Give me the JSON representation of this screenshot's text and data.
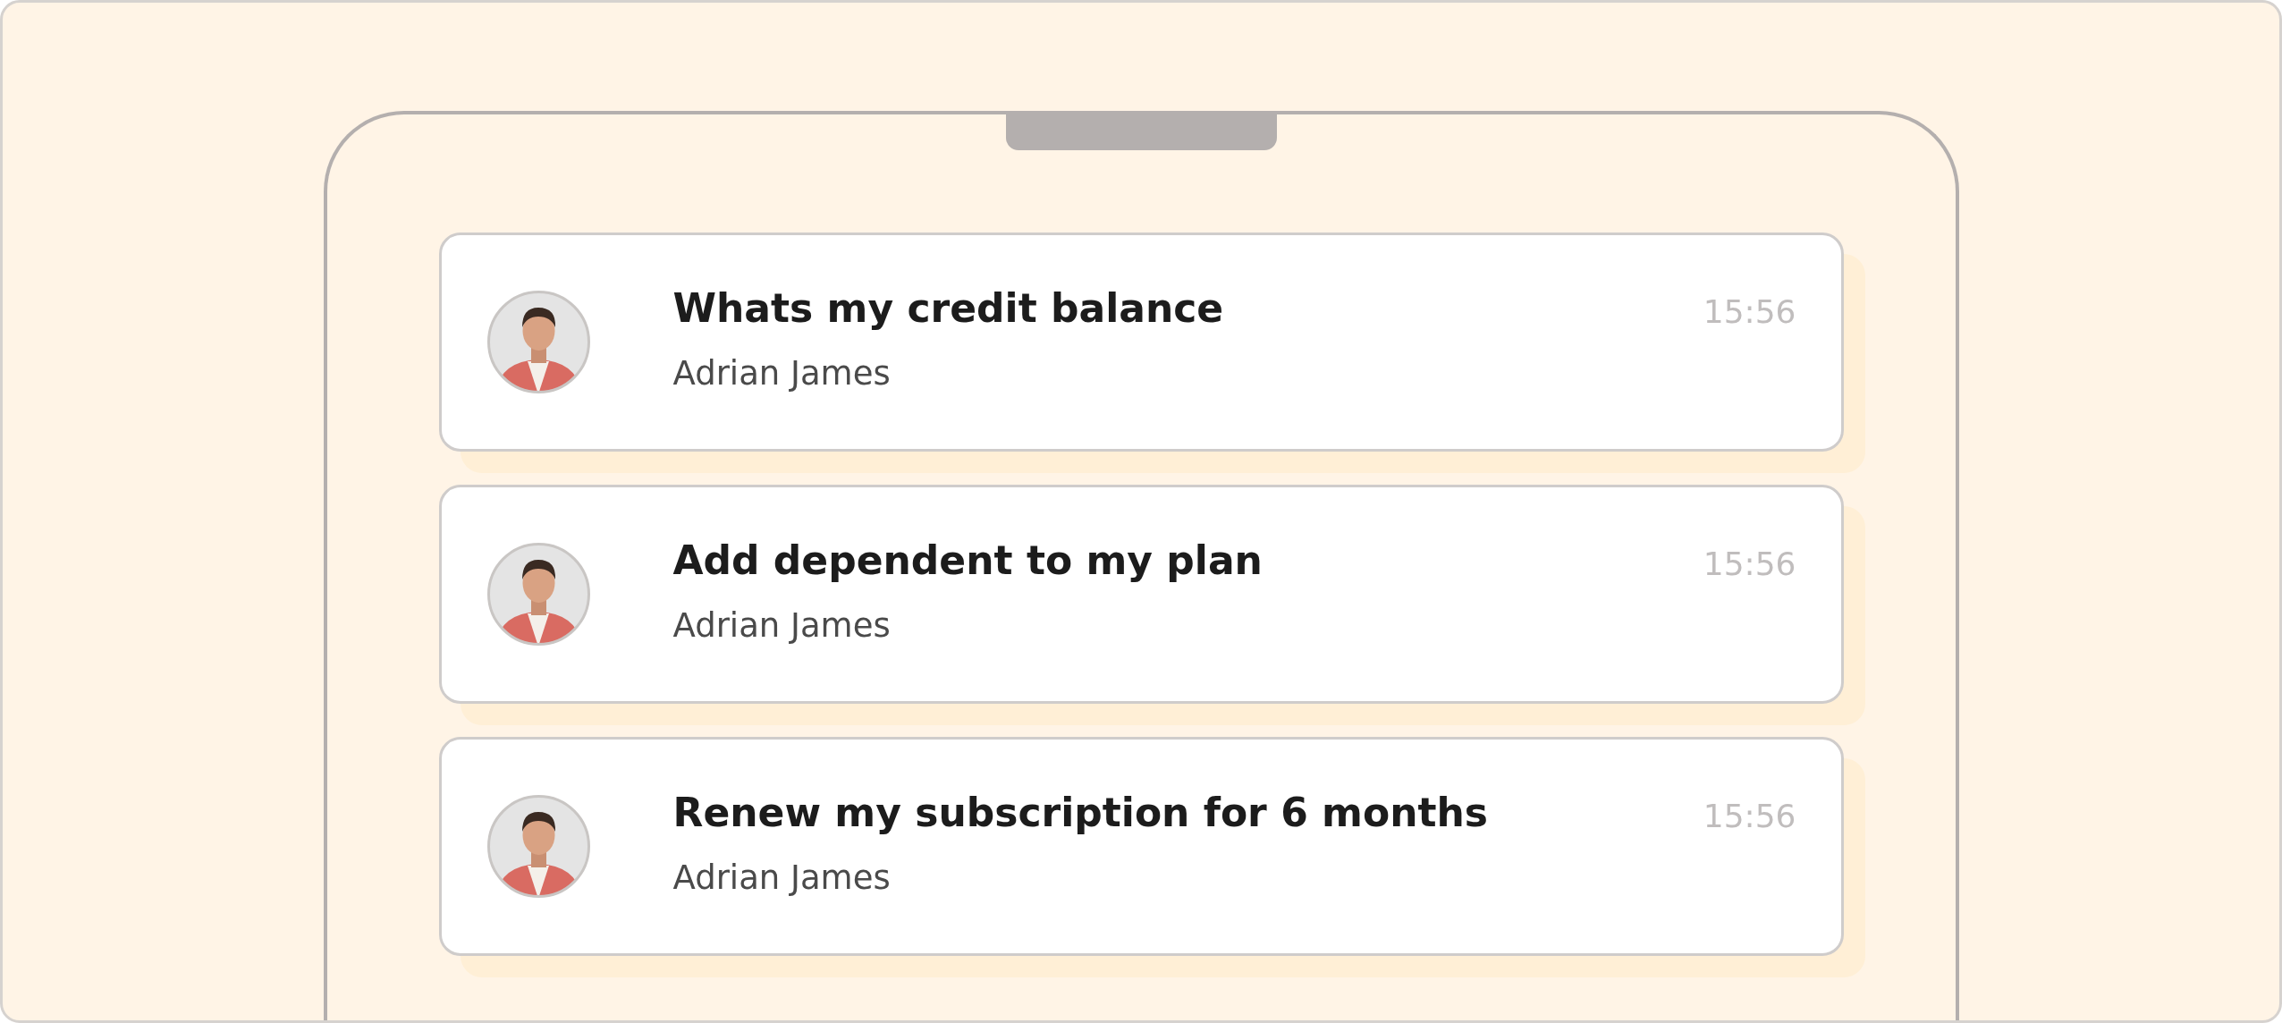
{
  "notifications": [
    {
      "title": "Whats my credit balance",
      "sender": "Adrian James",
      "time": "15:56"
    },
    {
      "title": "Add dependent to my plan",
      "sender": "Adrian James",
      "time": "15:56"
    },
    {
      "title": "Renew my subscription for 6 months",
      "sender": "Adrian James",
      "time": "15:56"
    }
  ]
}
